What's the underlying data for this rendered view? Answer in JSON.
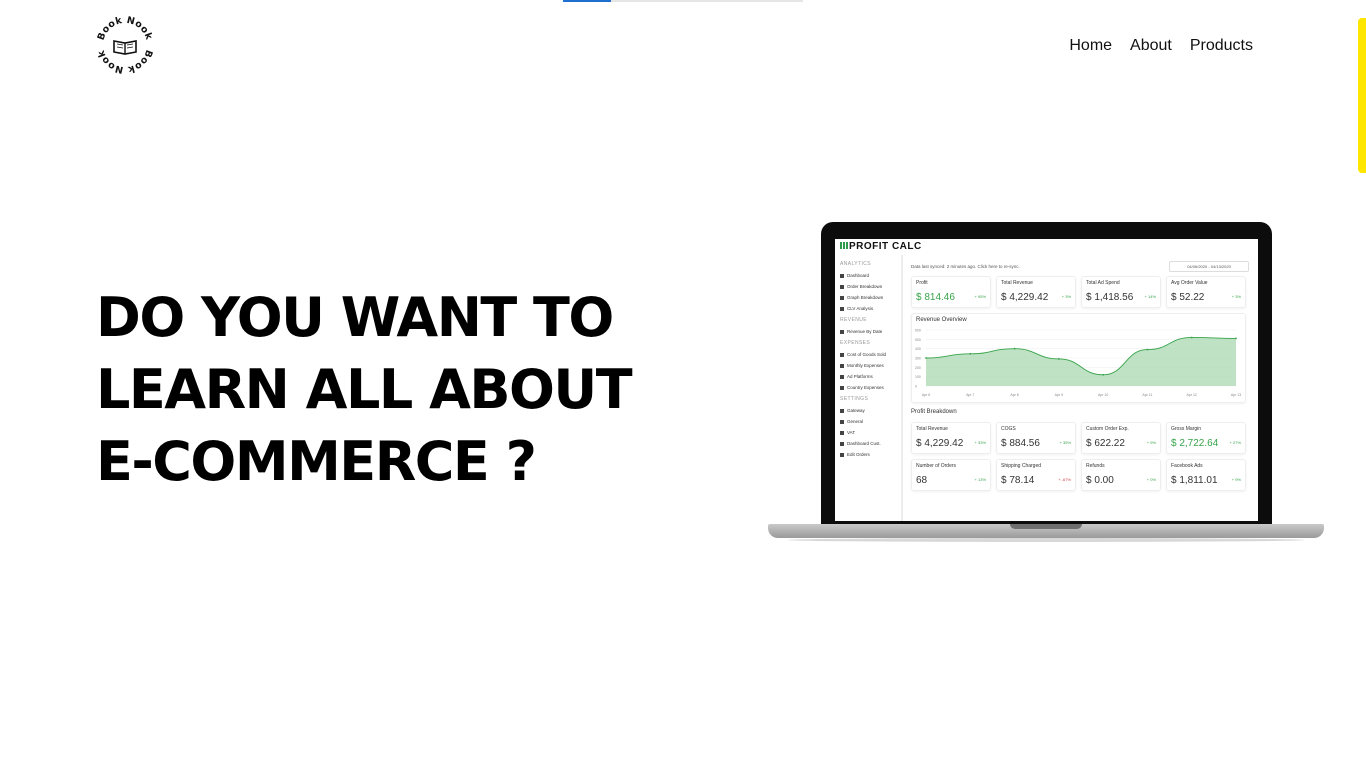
{
  "brand": {
    "logo_text": "Book Nook"
  },
  "nav": [
    {
      "label": "Home"
    },
    {
      "label": "About"
    },
    {
      "label": "Products"
    }
  ],
  "page_progress": 0.2,
  "hero": {
    "lines": [
      "DO YOU WANT TO",
      "LEARN ALL ABOUT",
      "E-COMMERCE ?"
    ]
  },
  "colors": {
    "accent_yellow": "#ffe600",
    "progress_blue": "#1f6fd1",
    "chart_green": "#37a34a"
  },
  "dashboard": {
    "title": "PROFIT CALC",
    "sidebar": [
      {
        "type": "head",
        "label": "ANALYTICS"
      },
      {
        "type": "item",
        "label": "Dashboard"
      },
      {
        "type": "item",
        "label": "Order Breakdown"
      },
      {
        "type": "item",
        "label": "Graph Breakdown"
      },
      {
        "type": "item",
        "label": "CLV Analysis"
      },
      {
        "type": "head",
        "label": "REVENUE"
      },
      {
        "type": "item",
        "label": "Revenue By Date"
      },
      {
        "type": "head",
        "label": "EXPENSES"
      },
      {
        "type": "item",
        "label": "Cost of Goods Sold"
      },
      {
        "type": "item",
        "label": "Monthly Expenses"
      },
      {
        "type": "item",
        "label": "Ad Platforms"
      },
      {
        "type": "item",
        "label": "Country Expenses"
      },
      {
        "type": "head",
        "label": "SETTINGS"
      },
      {
        "type": "item",
        "label": "Gateway"
      },
      {
        "type": "item",
        "label": "General"
      },
      {
        "type": "item",
        "label": "VAT"
      },
      {
        "type": "item",
        "label": "Dashboard Cust."
      },
      {
        "type": "item",
        "label": "Edit Orders"
      }
    ],
    "sync_text": "Data last synced: 2 minutes ago. Click here to re-sync.",
    "date_range": "04/06/2020 - 04/13/2020",
    "top_cards": [
      {
        "label": "Profit",
        "value": "$ 814.46",
        "delta": "+ 95%",
        "highlight": true
      },
      {
        "label": "Total Revenue",
        "value": "$ 4,229.42",
        "delta": "+ 3%",
        "highlight": false
      },
      {
        "label": "Total Ad Spend",
        "value": "$ 1,418.56",
        "delta": "+ 14%",
        "highlight": false
      },
      {
        "label": "Avg Order Value",
        "value": "$ 52.22",
        "delta": "+ 3%",
        "highlight": false
      }
    ],
    "revenue_chart": {
      "title": "Revenue Overview",
      "x_labels": [
        "Apr 6",
        "Apr 7",
        "Apr 8",
        "Apr 9",
        "Apr 10",
        "Apr 11",
        "Apr 12",
        "Apr 13"
      ],
      "y_ticks": [
        "600",
        "500",
        "400",
        "300",
        "200",
        "100",
        "0"
      ],
      "values": [
        300,
        345,
        400,
        290,
        120,
        390,
        520,
        510
      ]
    },
    "breakdown_title": "Profit Breakdown",
    "breakdown_cards": [
      {
        "label": "Total Revenue",
        "value": "$ 4,229.42",
        "delta": "+ 33%",
        "highlight": false,
        "negative": false
      },
      {
        "label": "COGS",
        "value": "$ 884.56",
        "delta": "+ 35%",
        "highlight": false,
        "negative": false
      },
      {
        "label": "Custom Order Exp.",
        "value": "$ 622.22",
        "delta": "+ 9%",
        "highlight": false,
        "negative": false
      },
      {
        "label": "Gross Margin",
        "value": "$ 2,722.64",
        "delta": "+ 27%",
        "highlight": true,
        "negative": false
      },
      {
        "label": "Number of Orders",
        "value": "68",
        "delta": "+ 13%",
        "highlight": false,
        "negative": false
      },
      {
        "label": "Shipping Charged",
        "value": "$ 78.14",
        "delta": "+ -67%",
        "highlight": false,
        "negative": true
      },
      {
        "label": "Refunds",
        "value": "$ 0.00",
        "delta": "+ 0%",
        "highlight": false,
        "negative": false
      },
      {
        "label": "Facebook Ads",
        "value": "$ 1,811.01",
        "delta": "+ 9%",
        "highlight": false,
        "negative": false
      }
    ]
  }
}
